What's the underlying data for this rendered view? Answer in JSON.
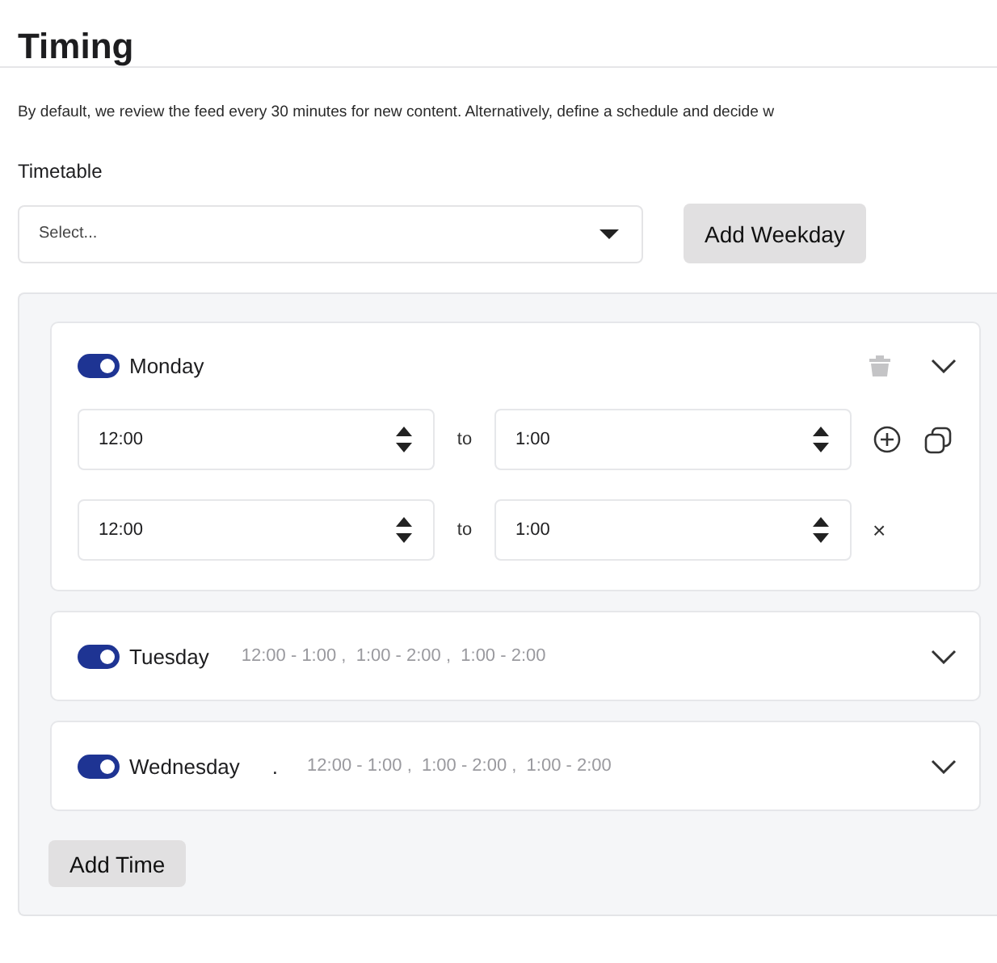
{
  "title": "Timing",
  "description": "By default, we review the feed every 30 minutes for new content. Alternatively, define a schedule and decide w",
  "timetable": {
    "label": "Timetable",
    "placeholder": "Select..."
  },
  "add_weekday_button": "Add Weekday",
  "days": [
    {
      "name": "Monday",
      "on": true,
      "expanded": true,
      "ranges": [
        {
          "from": "12:00",
          "separator": "to",
          "to": "1:00",
          "kind": "first"
        },
        {
          "from": "12:00",
          "separator": "to",
          "to": "1:00",
          "kind": "extra",
          "remove": "×"
        }
      ]
    },
    {
      "name": "Tuesday",
      "on": true,
      "expanded": false,
      "summary": "12:00 - 1:00 ,  1:00 - 2:00 ,  1:00 - 2:00"
    },
    {
      "name": "Wednesday",
      "on": true,
      "expanded": false,
      "mark": ".",
      "summary": "12:00 - 1:00 ,  1:00 - 2:00 ,  1:00 - 2:00"
    }
  ],
  "add_time_button": "Add Time"
}
